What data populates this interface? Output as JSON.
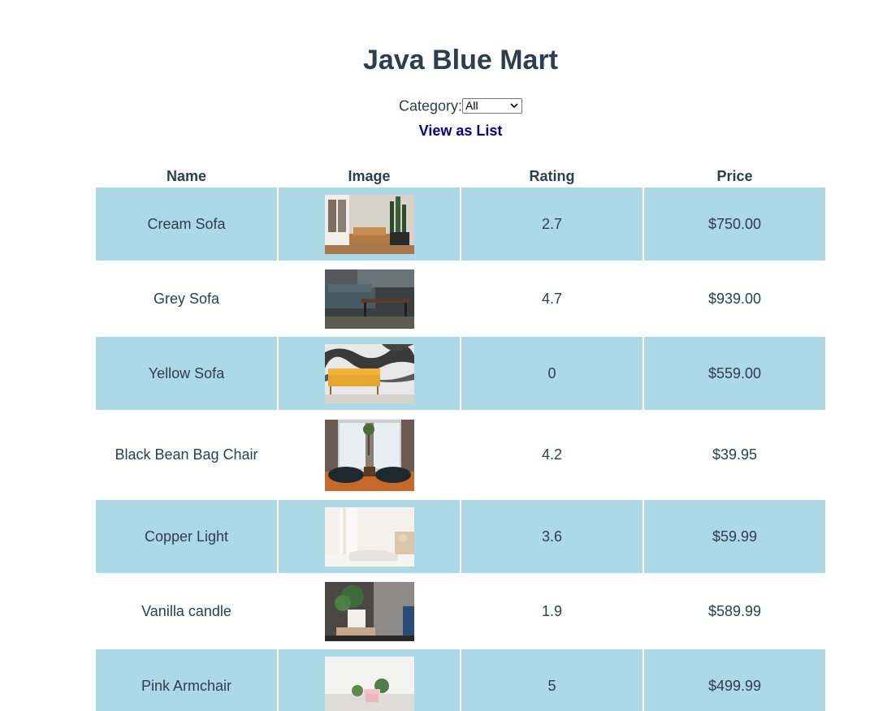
{
  "header": {
    "title": "Java Blue Mart"
  },
  "filter": {
    "label": "Category:",
    "selected": "All"
  },
  "view_toggle": {
    "label": "View as List"
  },
  "table": {
    "columns": [
      "Name",
      "Image",
      "Rating",
      "Price"
    ],
    "rows": [
      {
        "name": "Cream Sofa",
        "rating": "2.7",
        "price": "$750.00"
      },
      {
        "name": "Grey Sofa",
        "rating": "4.7",
        "price": "$939.00"
      },
      {
        "name": "Yellow Sofa",
        "rating": "0",
        "price": "$559.00"
      },
      {
        "name": "Black Bean Bag Chair",
        "rating": "4.2",
        "price": "$39.95"
      },
      {
        "name": "Copper Light",
        "rating": "3.6",
        "price": "$59.99"
      },
      {
        "name": "Vanilla candle",
        "rating": "1.9",
        "price": "$589.99"
      },
      {
        "name": "Pink Armchair",
        "rating": "5",
        "price": "$499.99"
      }
    ]
  },
  "colors": {
    "stripe": "#add8e6",
    "text": "#2c3e50",
    "link": "#000080"
  }
}
